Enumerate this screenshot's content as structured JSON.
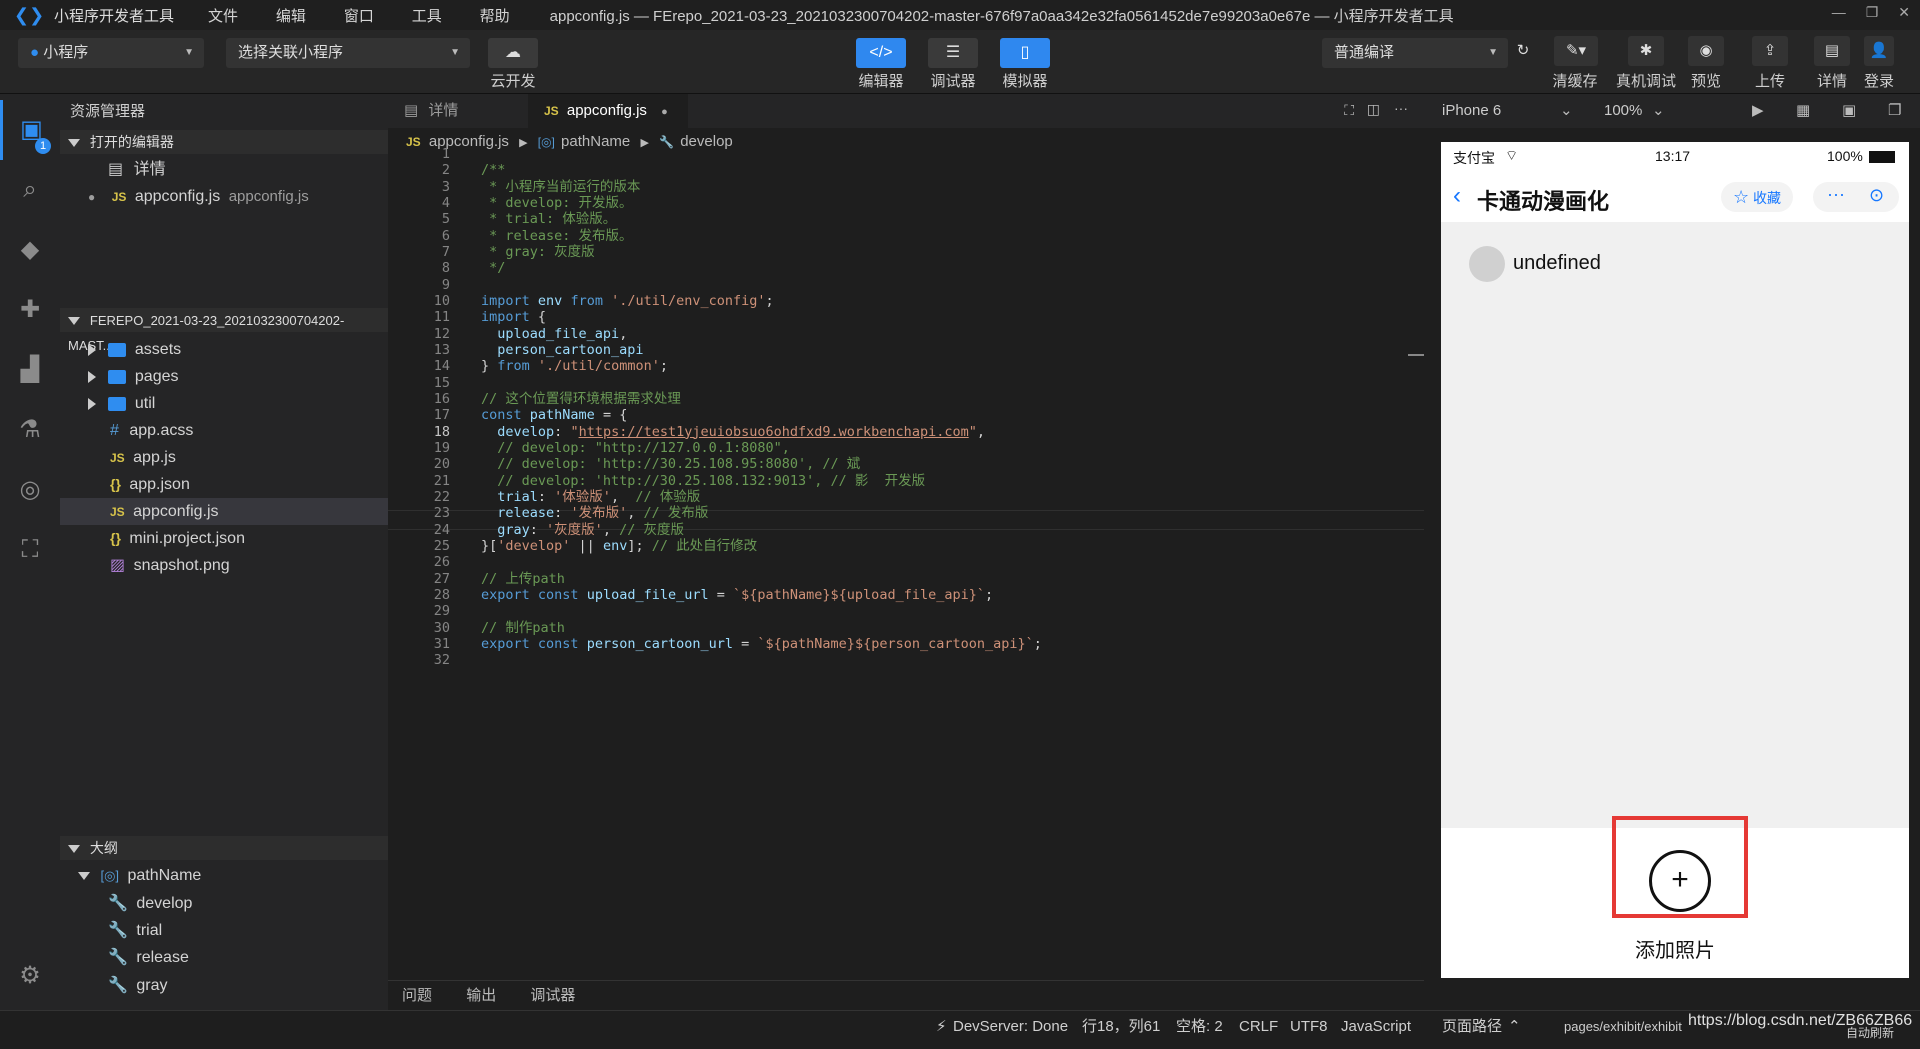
{
  "titlebar": {
    "app_name": "小程序开发者工具",
    "menu": [
      "文件",
      "编辑",
      "窗口",
      "工具",
      "帮助"
    ],
    "window_title": "appconfig.js — FErepo_2021-03-23_2021032300704202-master-676f97a0aa342e32fa0561452de7e99203a0e67e — 小程序开发者工具"
  },
  "toolbar": {
    "project_type": "小程序",
    "link_placeholder": "选择关联小程序",
    "cloud_label": "云开发",
    "editor_label": "编辑器",
    "debugger_label": "调试器",
    "simulator_label": "模拟器",
    "compile_mode": "普通编译",
    "clear_cache_label": "清缓存",
    "real_debug_label": "真机调试",
    "preview_label": "预览",
    "upload_label": "上传",
    "details_label": "详情",
    "login_label": "登录"
  },
  "activity": {
    "badge_count": "1"
  },
  "sidebar": {
    "title": "资源管理器",
    "open_editors_header": "打开的编辑器",
    "open_editors": [
      {
        "name": "详情"
      },
      {
        "name": "appconfig.js",
        "path": "appconfig.js"
      }
    ],
    "project_header": "FEREPO_2021-03-23_2021032300704202-MAST...",
    "tree": [
      {
        "name": "assets"
      },
      {
        "name": "pages"
      },
      {
        "name": "util"
      },
      {
        "name": "app.acss"
      },
      {
        "name": "app.js"
      },
      {
        "name": "app.json"
      },
      {
        "name": "appconfig.js"
      },
      {
        "name": "mini.project.json"
      },
      {
        "name": "snapshot.png"
      }
    ],
    "outline_header": "大纲",
    "outline": [
      "pathName",
      "develop",
      "trial",
      "release",
      "gray"
    ]
  },
  "editor": {
    "tabs": [
      "详情",
      "appconfig.js"
    ],
    "breadcrumb": [
      "appconfig.js",
      "pathName",
      "develop"
    ],
    "lines": [
      "",
      "/**",
      " * 小程序当前运行的版本",
      " * develop: 开发版。",
      " * trial: 体验版。",
      " * release: 发布版。",
      " * gray: 灰度版",
      " */",
      "",
      "import env from './util/env_config';",
      "import {",
      "  upload_file_api,",
      "  person_cartoon_api",
      "} from './util/common';",
      "",
      "// 这个位置得环境根据需求处理",
      "const pathName = {",
      "  develop: \"https://test1yjeuiobsuo6ohdfxd9.workbenchapi.com\",",
      "  // develop: \"http://127.0.0.1:8080\",",
      "  // develop: 'http://30.25.108.95:8080', // 斌",
      "  // develop: 'http://30.25.108.132:9013', // 影  开发版",
      "  trial: '体验版',  // 体验版",
      "  release: '发布版', // 发布版",
      "  gray: '灰度版', // 灰度版",
      "}['develop' || env]; // 此处自行修改",
      "",
      "// 上传path",
      "export const upload_file_url = `${pathName}${upload_file_api}`;",
      "",
      "// 制作path",
      "export const person_cartoon_url = `${pathName}${person_cartoon_api}`;",
      ""
    ],
    "bottom_tabs": [
      "问题",
      "输出",
      "调试器"
    ]
  },
  "simulator": {
    "device": "iPhone 6",
    "zoom": "100%",
    "carrier": "支付宝",
    "time": "13:17",
    "battery": "100%",
    "page_title": "卡通动漫画化",
    "favorite_label": "收藏",
    "user_name": "undefined",
    "add_photo_label": "添加照片"
  },
  "statusbar": {
    "devserver": "DevServer: Done",
    "position": "行18，列61",
    "indent": "空格: 2",
    "eol": "CRLF",
    "encoding": "UTF8",
    "language": "JavaScript",
    "page_path_label": "页面路径",
    "page_path": "pages/exhibit/exhibit",
    "watermark": "https://blog.csdn.net/ZB66ZB66",
    "auto_refresh": "自动刷新"
  },
  "colors": {
    "accent": "#2f88ef",
    "highlight_box": "#e53935"
  }
}
